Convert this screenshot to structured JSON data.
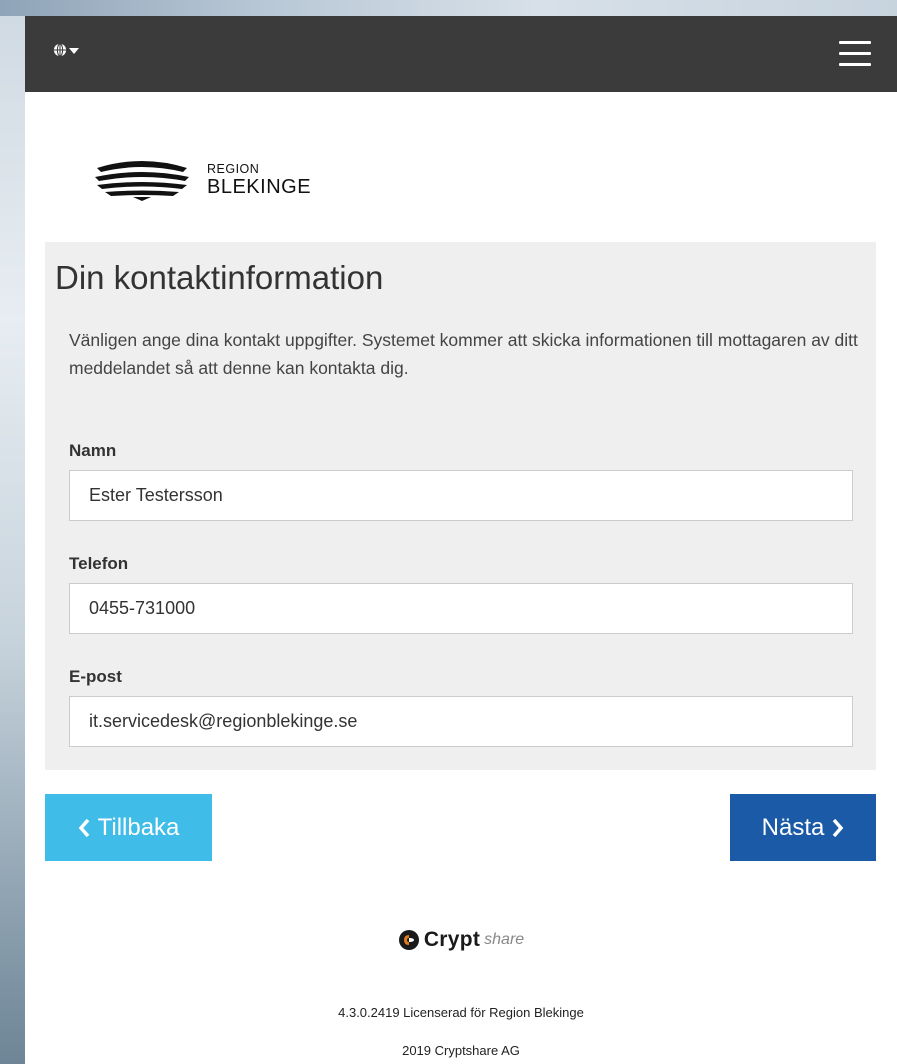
{
  "header": {
    "lang_icon": "globe-icon",
    "menu_icon": "hamburger-menu-icon"
  },
  "logo": {
    "line1": "REGION",
    "line2": "BLEKINGE"
  },
  "form": {
    "title": "Din kontaktinformation",
    "description": "Vänligen ange dina kontakt uppgifter. Systemet kommer att skicka informationen till mottagaren av ditt meddelandet så att denne kan kontakta dig.",
    "fields": [
      {
        "label": "Namn",
        "value": "Ester Testersson"
      },
      {
        "label": "Telefon",
        "value": "0455-731000"
      },
      {
        "label": "E-post",
        "value": "it.servicedesk@regionblekinge.se"
      }
    ]
  },
  "buttons": {
    "back_label": "Tillbaka",
    "next_label": "Nästa"
  },
  "footer": {
    "brand_bold": "Crypt",
    "brand_light": "share",
    "license": "4.3.0.2419 Licenserad för Region Blekinge",
    "copyright": "2019 Cryptshare AG"
  },
  "colors": {
    "navbar": "#3b3b3b",
    "back_button": "#3fbde8",
    "next_button": "#1a5aa6",
    "panel": "#efefef"
  }
}
